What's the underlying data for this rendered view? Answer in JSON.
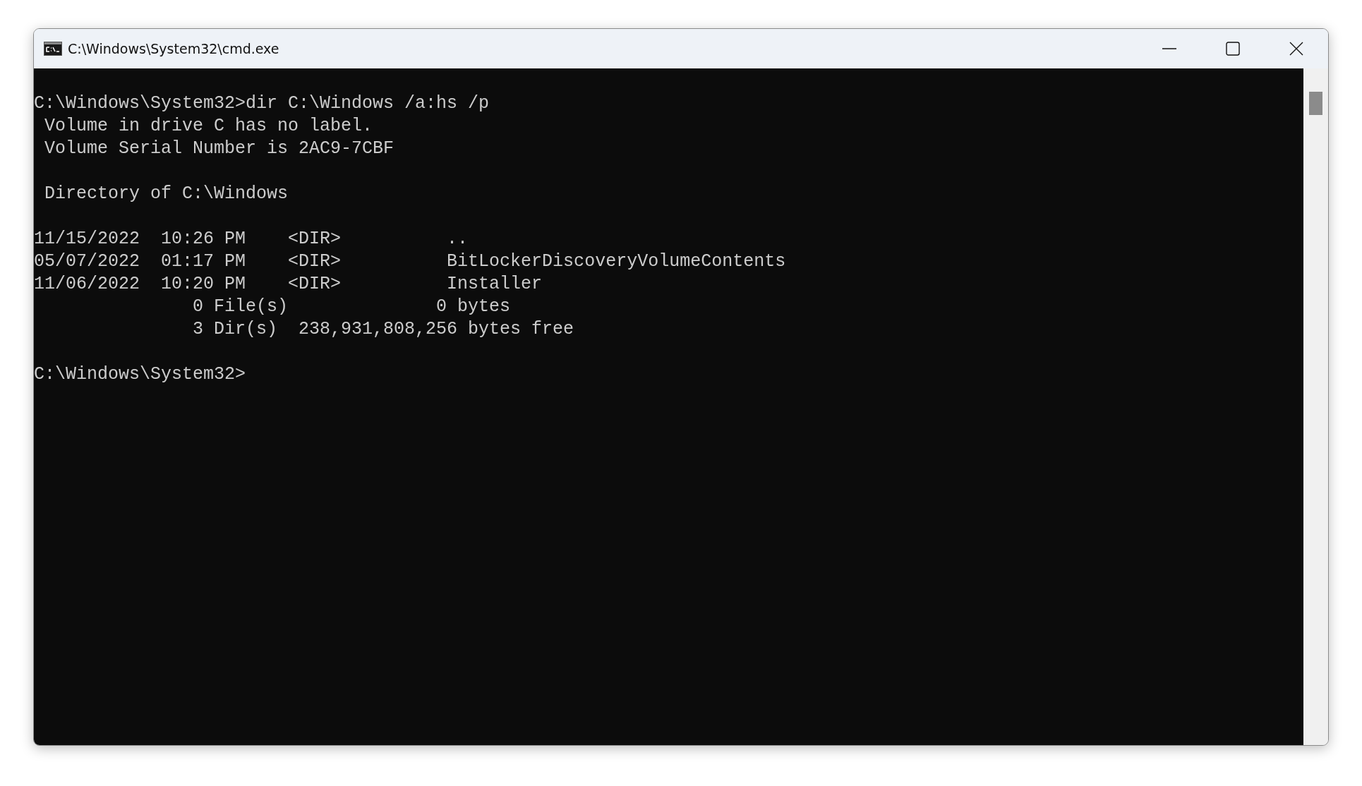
{
  "window": {
    "title": "C:\\Windows\\System32\\cmd.exe"
  },
  "console": {
    "blocks": [
      [
        "C:\\Windows\\System32>dir C:\\Windows /a:hs /p",
        " Volume in drive C has no label.",
        " Volume Serial Number is 2AC9-7CBF"
      ],
      [
        " Directory of C:\\Windows"
      ],
      [
        "11/15/2022  10:26 PM    <DIR>          ..",
        "05/07/2022  01:17 PM    <DIR>          BitLockerDiscoveryVolumeContents",
        "11/06/2022  10:20 PM    <DIR>          Installer",
        "               0 File(s)              0 bytes",
        "               3 Dir(s)  238,931,808,256 bytes free"
      ],
      [
        "C:\\Windows\\System32>"
      ]
    ]
  }
}
